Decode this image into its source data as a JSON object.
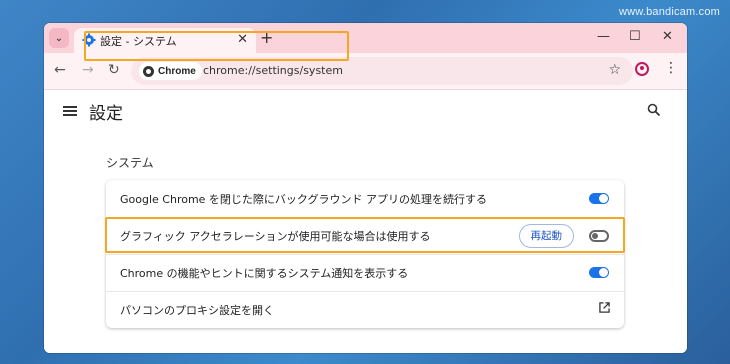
{
  "watermark": "www.bandicam.com",
  "tab": {
    "title": "設定 - システム",
    "close": "✕"
  },
  "new_tab": "+",
  "window_controls": {
    "minimize": "—",
    "maximize": "☐",
    "close": "✕"
  },
  "toolbar": {
    "back": "←",
    "forward": "→",
    "reload": "↻",
    "menu": "⋮"
  },
  "omnibox": {
    "chip_label": "Chrome",
    "url": "chrome://settings/system",
    "bookmark": "☆"
  },
  "settings": {
    "page_title": "設定",
    "section_title": "システム",
    "rows": [
      {
        "label": "Google Chrome を閉じた際にバックグラウンド アプリの処理を続行する",
        "toggle": "on"
      },
      {
        "label": "グラフィック アクセラレーションが使用可能な場合は使用する",
        "toggle": "off",
        "button": "再起動"
      },
      {
        "label": "Chrome の機能やヒントに関するシステム通知を表示する",
        "toggle": "on"
      },
      {
        "label": "パソコンのプロキシ設定を開く"
      }
    ]
  },
  "colors": {
    "accent": "#1a73e8",
    "highlight": "#f5a623",
    "tabstrip": "#fbd3da"
  }
}
